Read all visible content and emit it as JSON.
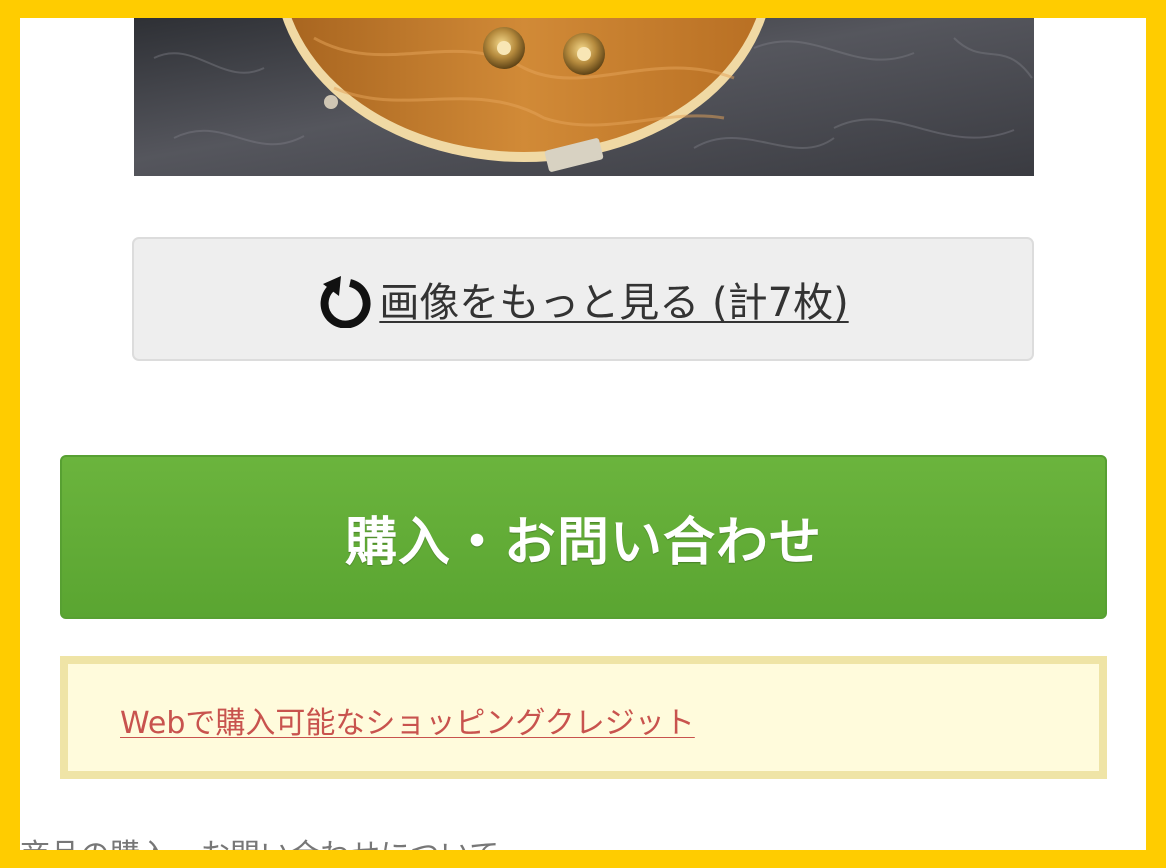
{
  "page": {
    "colors": {
      "page_border": "#ffcc00",
      "button_green": "#64ad38",
      "notice_background": "#fffbdc",
      "notice_border": "#efe4a6",
      "link_red": "#c8534e"
    }
  },
  "gallery": {
    "image_subject": "guitar",
    "more_button": {
      "icon": "refresh-icon",
      "label": "画像をもっと見る (計7枚)"
    }
  },
  "purchase": {
    "button_label": "購入・お問い合わせ"
  },
  "shopping_credit": {
    "link_text": "Webで購入可能なショッピングクレジット"
  },
  "footer": {
    "section_heading": "商品の購入・お問い合わせについて"
  }
}
